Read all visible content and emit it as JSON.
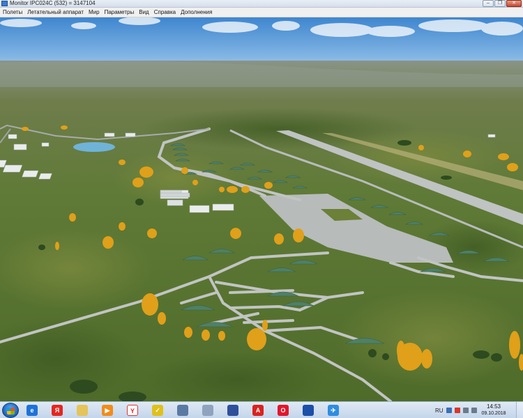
{
  "window": {
    "title": "Monitor IPC024C (532) = 3147104"
  },
  "menu": {
    "items": [
      "Полеты",
      "Летательный аппарат",
      "Мир",
      "Параметры",
      "Вид",
      "Справка",
      "Дополнения"
    ]
  },
  "taskbar": {
    "apps": [
      {
        "name": "internet-explorer-icon",
        "color": "#1e73d8",
        "glyph": "e"
      },
      {
        "name": "yandex-icon",
        "color": "#e52620",
        "glyph": "Я"
      },
      {
        "name": "folder-icon",
        "color": "#e5c45a",
        "glyph": ""
      },
      {
        "name": "media-player-icon",
        "color": "#f28c1b",
        "glyph": "▶"
      },
      {
        "name": "yandex-browser-icon",
        "color": "#ffffff",
        "glyph": "Y"
      },
      {
        "name": "security-icon",
        "color": "#e0c11a",
        "glyph": "✓"
      },
      {
        "name": "computer-icon",
        "color": "#5b7aa3",
        "glyph": ""
      },
      {
        "name": "calculator-icon",
        "color": "#8fa3bc",
        "glyph": ""
      },
      {
        "name": "save-disk-icon",
        "color": "#2f4f9a",
        "glyph": ""
      },
      {
        "name": "pdf-icon",
        "color": "#d9231e",
        "glyph": "A"
      },
      {
        "name": "opera-icon",
        "color": "#e3162b",
        "glyph": "O"
      },
      {
        "name": "network-app-icon",
        "color": "#1c4fa8",
        "glyph": ""
      },
      {
        "name": "flight-simulator-icon",
        "color": "#2f8de0",
        "glyph": "✈"
      }
    ],
    "language": "RU",
    "time": "14:53",
    "date": "09.10.2018"
  }
}
